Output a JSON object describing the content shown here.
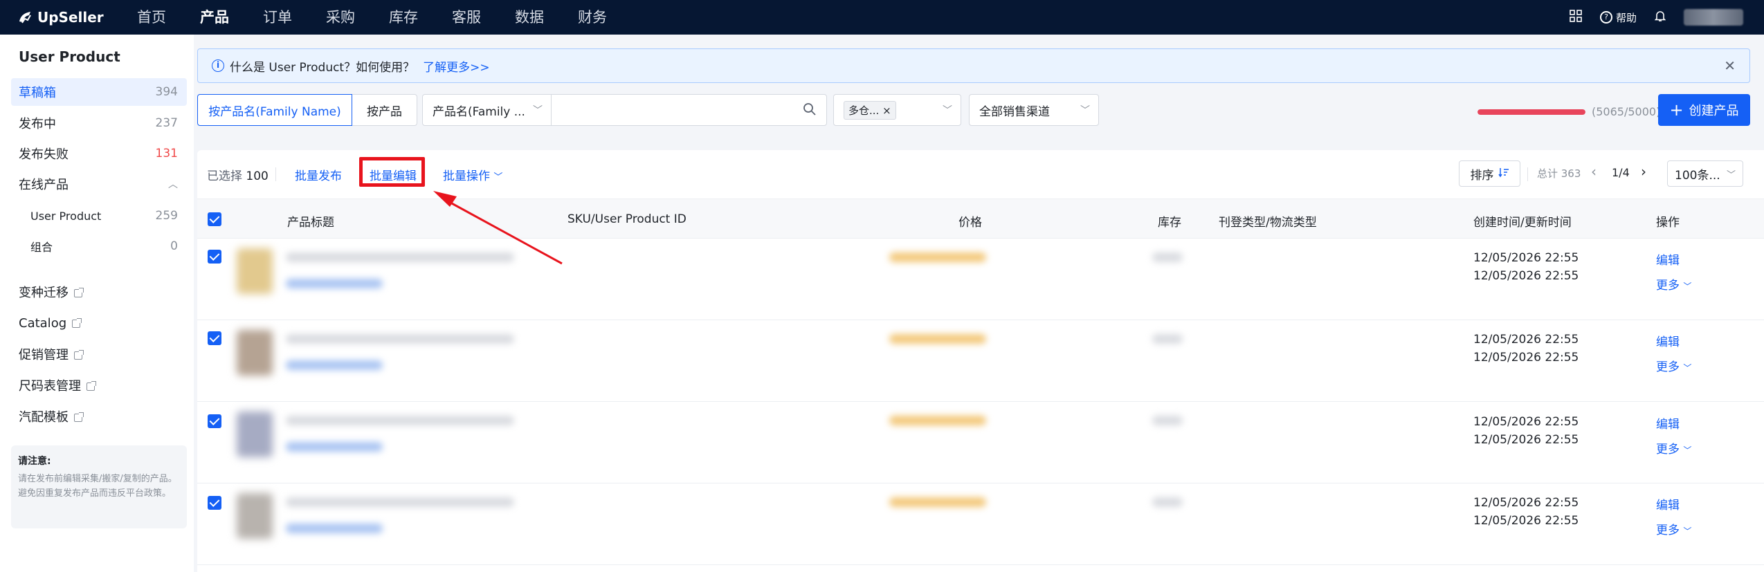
{
  "nav": {
    "brand": "UpSeller",
    "items": [
      {
        "label": "首页",
        "active": false
      },
      {
        "label": "产品",
        "active": true
      },
      {
        "label": "订单",
        "active": false
      },
      {
        "label": "采购",
        "active": false
      },
      {
        "label": "库存",
        "active": false
      },
      {
        "label": "客服",
        "active": false
      },
      {
        "label": "数据",
        "active": false
      },
      {
        "label": "财务",
        "active": false
      }
    ],
    "help_label": "帮助",
    "grid_icon": "apps-grid-icon",
    "bell_icon": "bell-icon"
  },
  "sidebar": {
    "title": "User Product",
    "items": [
      {
        "label": "草稿箱",
        "count": "394"
      },
      {
        "label": "发布中",
        "count": "237"
      },
      {
        "label": "发布失败",
        "count": "131"
      },
      {
        "label": "在线产品",
        "count": ""
      },
      {
        "label": "User Product",
        "count": "259"
      },
      {
        "label": "组合",
        "count": "0"
      },
      {
        "label": "变种迁移",
        "count": ""
      },
      {
        "label": "Catalog",
        "count": ""
      },
      {
        "label": "促销管理",
        "count": ""
      },
      {
        "label": "尺码表管理",
        "count": ""
      },
      {
        "label": "汽配模板",
        "count": ""
      }
    ],
    "note_title": "请注意:",
    "note_body": "请在发布前编辑采集/搬家/复制的产品。避免因重复发布产品而违反平台政策。"
  },
  "banner": {
    "text": "什么是 User Product？如何使用？",
    "link": "了解更多>>"
  },
  "filters": {
    "seg_family": "按产品名(Family Name)",
    "seg_product": "按产品",
    "field_select": "产品名(Family ...",
    "search_placeholder": "",
    "warehouse_tag": "多仓...",
    "channel_select": "全部销售渠道",
    "progress_text": "(5065/5000)",
    "progress_fraction": 1.0,
    "create_button": "创建产品"
  },
  "toolbar": {
    "selected_label": "已选择",
    "selected_count": "100",
    "batch_publish": "批量发布",
    "batch_edit": "批量编辑",
    "batch_ops": "批量操作",
    "sort_label": "排序",
    "total_label": "总计 363",
    "page": "1/4",
    "page_size": "100条..."
  },
  "table": {
    "headers": [
      "产品标题",
      "SKU/User Product ID",
      "价格",
      "库存",
      "刊登类型/物流类型",
      "创建时间/更新时间",
      "操作"
    ],
    "rows": [
      {
        "created": "12/05/2026 22:55",
        "updated": "12/05/2026 22:55",
        "edit": "编辑",
        "more": "更多"
      },
      {
        "created": "12/05/2026 22:55",
        "updated": "12/05/2026 22:55",
        "edit": "编辑",
        "more": "更多"
      },
      {
        "created": "12/05/2026 22:55",
        "updated": "12/05/2026 22:55",
        "edit": "编辑",
        "more": "更多"
      },
      {
        "created": "12/05/2026 22:55",
        "updated": "12/05/2026 22:55",
        "edit": "编辑",
        "more": "更多"
      }
    ]
  },
  "colors": {
    "nav_bg": "#061733",
    "accent": "#1560f5",
    "highlight": "#e8141d",
    "progress": "#e8455c"
  }
}
